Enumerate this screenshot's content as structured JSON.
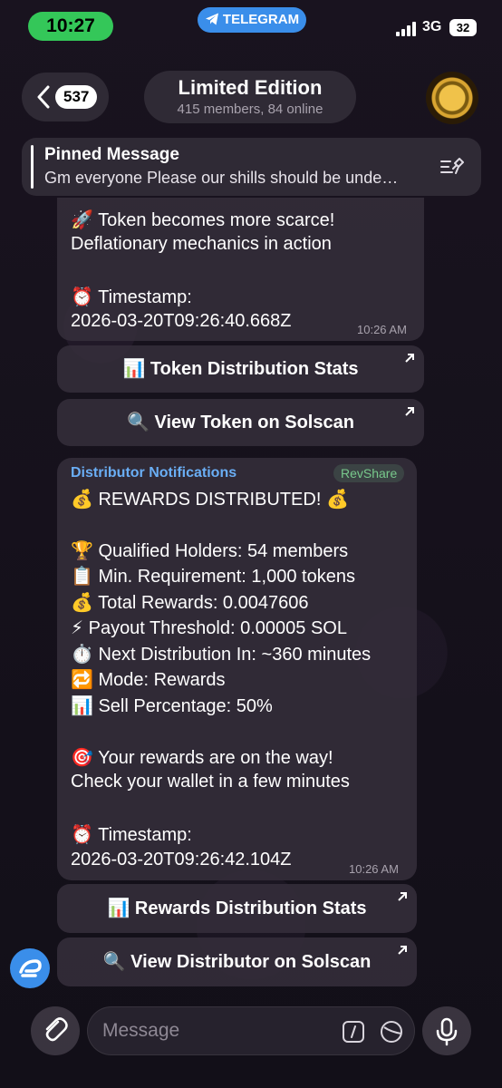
{
  "status": {
    "time": "10:27",
    "telegram_label": "TELEGRAM",
    "network": "3G",
    "battery": "32"
  },
  "header": {
    "back_count": "537",
    "title": "Limited Edition",
    "subtitle": "415 members, 84 online"
  },
  "pinned": {
    "title": "Pinned Message",
    "text": "Gm everyone Please our shills should be unde…"
  },
  "message1": {
    "lines": [
      "🚀 Token becomes more scarce!",
      "Deflationary mechanics in action",
      "⏰ Timestamp:",
      "2026-03-20T09:26:40.668Z"
    ],
    "time": "10:26 AM",
    "buttons": [
      "📊 Token Distribution Stats",
      "🔍 View Token on Solscan"
    ]
  },
  "message2": {
    "sender": "Distributor Notifications",
    "tag": "RevShare",
    "lines": [
      "💰 REWARDS DISTRIBUTED! 💰",
      "🏆 Qualified Holders: 54 members",
      "📋 Min. Requirement: 1,000 tokens",
      "💰 Total Rewards: 0.0047606",
      "⚡ Payout Threshold: 0.00005 SOL",
      "⏱️ Next Distribution In: ~360 minutes",
      "🔁 Mode: Rewards",
      "📊 Sell Percentage: 50%",
      "🎯 Your rewards are on the way!",
      "Check your wallet in a few minutes",
      "⏰ Timestamp:",
      "2026-03-20T09:26:42.104Z"
    ],
    "time": "10:26 AM",
    "buttons": [
      "📊 Rewards Distribution Stats",
      "🔍 View Distributor on Solscan"
    ]
  },
  "composer": {
    "placeholder": "Message"
  },
  "colors": {
    "accent": "#3a8eea",
    "status_green": "#34c759",
    "sender_blue": "#6aaef5",
    "tag_green": "#78c98c"
  }
}
